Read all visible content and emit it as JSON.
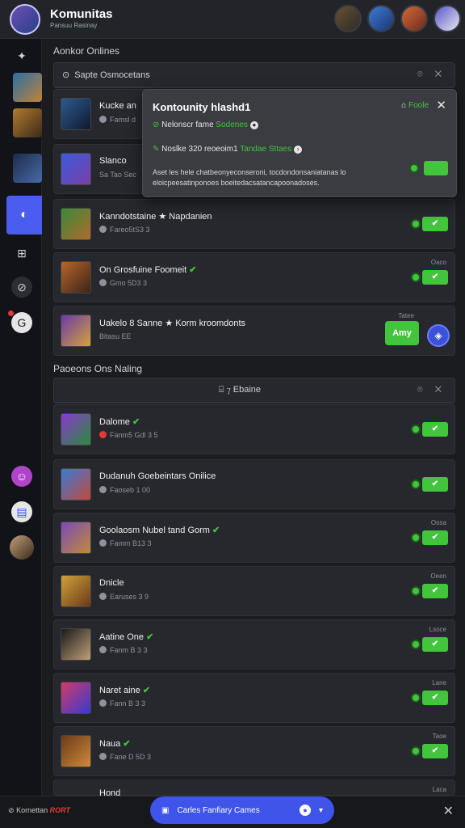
{
  "header": {
    "title": "Komunitas",
    "subtitle": "Pansuu Rasinay"
  },
  "sections": {
    "online_title": "Aonkor Onlines",
    "second_title": "Paoeons Ons Naling"
  },
  "panel1": {
    "title": "Sapte Osmocetans",
    "controls": "⌾ ✕"
  },
  "panel2": {
    "title": "⌸ ⁊ Ebaine",
    "controls": "⌾ ✕"
  },
  "popup": {
    "title": "Kontounity hlashd1",
    "line1_prefix": "Nelonscr fame",
    "line1_green": "Sodenes",
    "line2_prefix": "Noslke 320 reoeoim1",
    "line2_green": "Tandae Sttaes",
    "description": "Aset les hele chatbeonyeconseroni, tocdondonsaniatanas lo eloicpeesatinponoes boeitedacsatancapoonadoses.",
    "top_label": "Foole"
  },
  "online_rows": [
    {
      "name": "Kucke  an",
      "meta": "Famsl  d"
    },
    {
      "name": "Slanco",
      "meta": "Sa  Tao Sec"
    },
    {
      "name": "Kanndotstaine  ★  Napdanien",
      "meta": "Fareo5tS3 3"
    },
    {
      "name": "On Grosfuine Foomeit",
      "meta": "Gmo 5D3 3",
      "small": "Oaco"
    },
    {
      "name": "Uakelo 8 Sanne  ★  Korm kroomdonts",
      "meta": "Bitasu EE",
      "small": "Tatee",
      "button": "Amy"
    }
  ],
  "second_rows": [
    {
      "name": "Dalome",
      "meta": "Fanm5 Gdl 3 5"
    },
    {
      "name": "Dudanuh Goebeintars Onilice",
      "meta": "Faoseb  1 00"
    },
    {
      "name": "Goolaosm Nubel tand Gorm",
      "meta": "Famm  B13 3",
      "small": "Oosa"
    },
    {
      "name": "Dnicle",
      "meta": "Earuses 3 9",
      "small": "Oeen"
    },
    {
      "name": "Aatine One",
      "meta": "Fanm  B 3 3",
      "small": "Lsoce"
    },
    {
      "name": "Naret  aine",
      "meta": "Fann  B 3 3",
      "small": "Lane"
    },
    {
      "name": "Naua",
      "meta": "Fane  D 5D 3",
      "small": "Taoe"
    },
    {
      "name": "Hond",
      "meta": "",
      "small": "Laca"
    }
  ],
  "bottom": {
    "left_label": "Kornettan",
    "left_red": "RORT",
    "pill_label": "Carles Fanfiary Cames"
  },
  "colors": {
    "accent": "#43c43d",
    "brand": "#3f54e8",
    "bg": "#1b1c20"
  }
}
